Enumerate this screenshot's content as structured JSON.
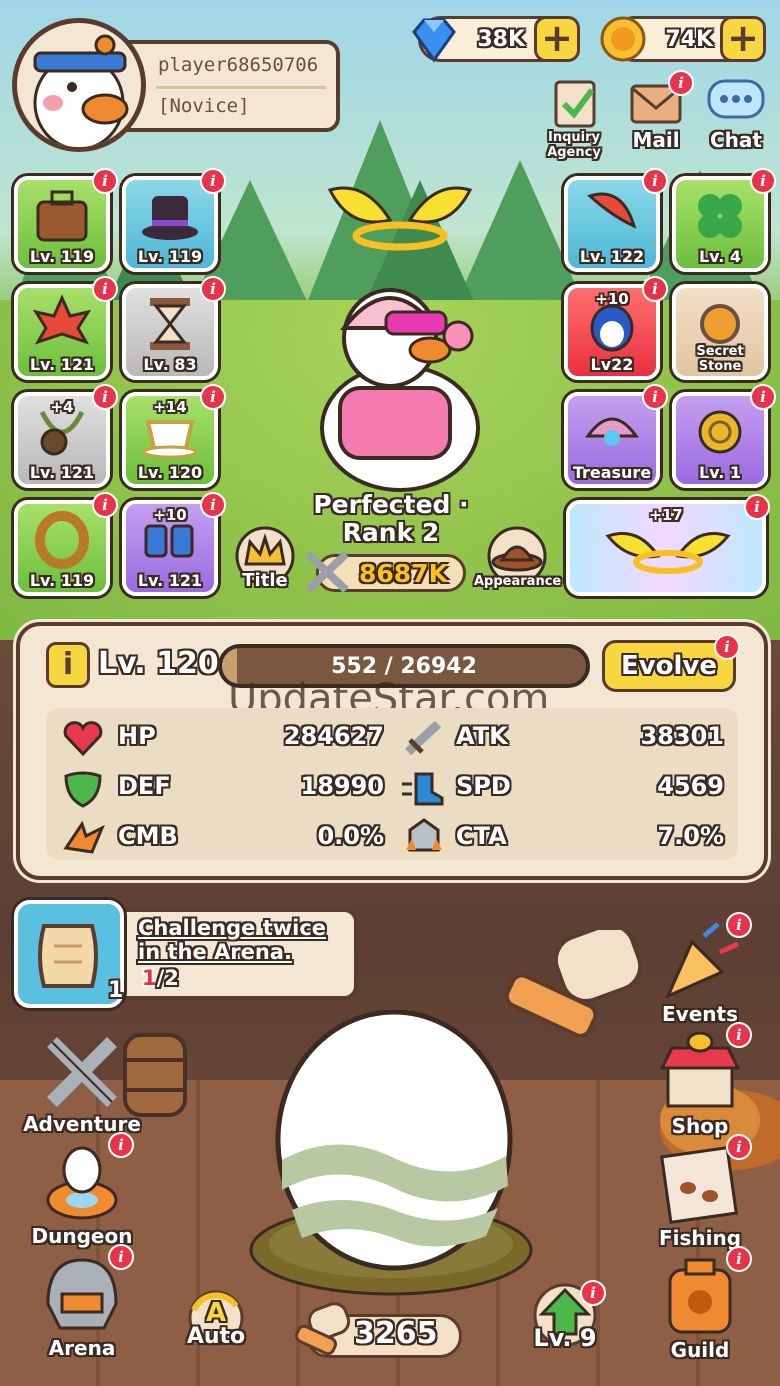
{
  "player": {
    "name": "player68650706",
    "rank": "[Novice]"
  },
  "currency": {
    "gems": "38K",
    "coins": "74K"
  },
  "top_nav": {
    "inquiry": "Inquiry Agency",
    "mail": "Mail",
    "chat": "Chat"
  },
  "left_equipment": [
    {
      "level": "Lv. 119",
      "icon": "suitcase-icon"
    },
    {
      "level": "Lv. 119",
      "icon": "top-hat-icon"
    },
    {
      "level": "Lv. 121",
      "icon": "maple-leaf-icon"
    },
    {
      "level": "Lv. 83",
      "icon": "hourglass-icon"
    },
    {
      "level": "Lv. 121",
      "icon": "pendant-icon",
      "plus": "+4"
    },
    {
      "level": "Lv. 120",
      "icon": "teacup-icon",
      "plus": "+14"
    },
    {
      "level": "Lv. 119",
      "icon": "ring-icon"
    },
    {
      "level": "Lv. 121",
      "icon": "boots-icon",
      "plus": "+10"
    }
  ],
  "right_equipment": [
    {
      "label": "Lv. 122",
      "icon": "feather-icon"
    },
    {
      "label": "Lv. 4",
      "icon": "clover-icon"
    },
    {
      "label": "Lv22",
      "icon": "penguin-pet-icon",
      "plus": "+10"
    },
    {
      "label": "Secret Stone",
      "icon": "secret-stone-icon"
    },
    {
      "label": "Treasure",
      "icon": "clam-pearl-icon"
    },
    {
      "label": "Lv. 1",
      "icon": "golden-dragon-icon"
    }
  ],
  "halo_card": {
    "plus": "+17"
  },
  "character": {
    "title_line1": "Perfected ·",
    "title_line2": "Rank 2",
    "power": "8687K"
  },
  "buttons": {
    "title": "Title",
    "appearance": "Appearance",
    "evolve": "Evolve"
  },
  "level": {
    "label": "Lv. 120",
    "exp": "552 / 26942",
    "exp_fraction": 0.0205,
    "info": "i"
  },
  "watermark": "UpdateStar.com",
  "stats": [
    {
      "name": "HP",
      "value": "284627",
      "icon": "heart-icon"
    },
    {
      "name": "ATK",
      "value": "38301",
      "icon": "sword-icon"
    },
    {
      "name": "DEF",
      "value": "18990",
      "icon": "shield-icon"
    },
    {
      "name": "SPD",
      "value": "4569",
      "icon": "boot-speed-icon"
    },
    {
      "name": "CMB",
      "value": "0.0%",
      "icon": "combo-icon"
    },
    {
      "name": "CTA",
      "value": "7.0%",
      "icon": "counter-icon"
    }
  ],
  "quest": {
    "text_line1": "Challenge twice",
    "text_line2": "in the Arena.",
    "progress_done": "1",
    "progress_total": "/2",
    "badge": "1"
  },
  "left_menu": {
    "adventure": "Adventure",
    "dungeon": "Dungeon",
    "arena": "Arena"
  },
  "right_menu": {
    "events": "Events",
    "shop": "Shop",
    "fishing": "Fishing",
    "guild": "Guild"
  },
  "bottom": {
    "auto": "Auto",
    "auto_letter": "A",
    "hammers": "3265",
    "upgrade_level": "Lv. 9"
  },
  "colors": {
    "accent_yellow": "#f8d640",
    "badge_red": "#e8344a",
    "panel": "#f3e6d2",
    "outline": "#3a2a22"
  }
}
